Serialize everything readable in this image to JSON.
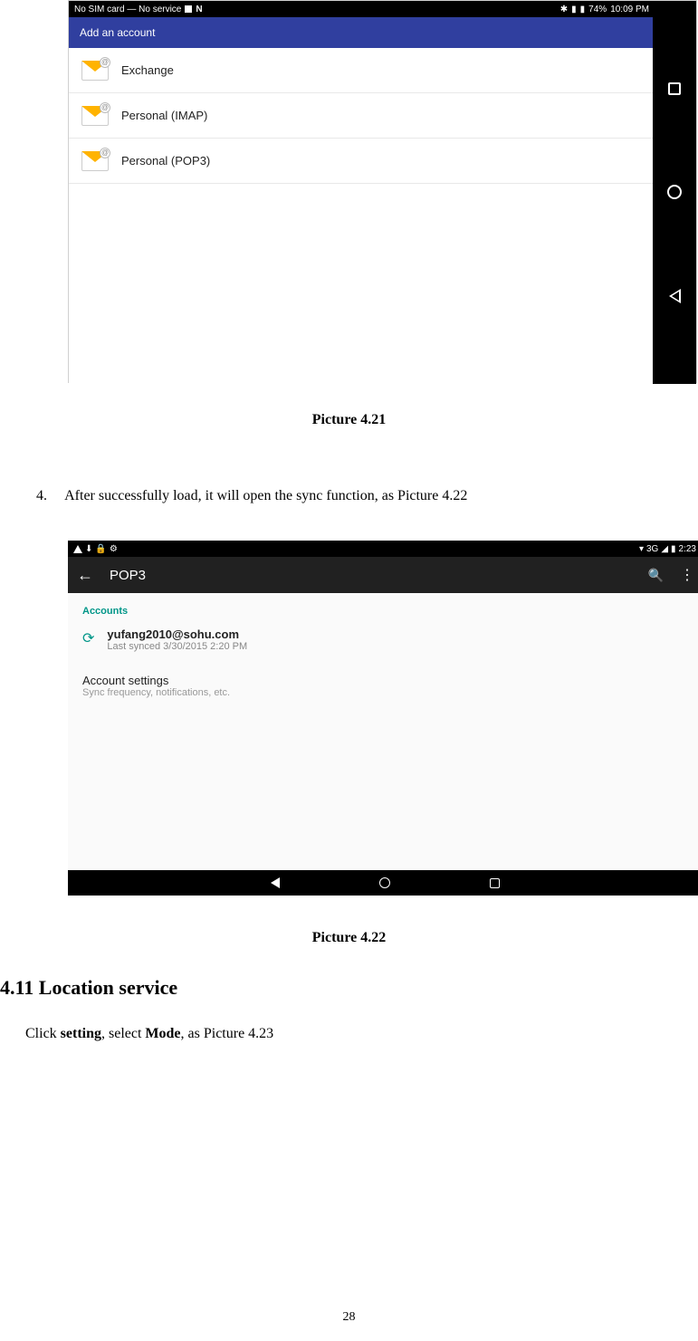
{
  "shot1": {
    "status": {
      "sim": "No SIM card — No service",
      "battery": "74%",
      "time": "10:09 PM"
    },
    "header": "Add an account",
    "rows": [
      "Exchange",
      "Personal (IMAP)",
      "Personal (POP3)"
    ]
  },
  "caption1": "Picture 4.21",
  "step4": {
    "num": "4.",
    "text": "After successfully load, it will open the sync function, as Picture 4.22"
  },
  "shot2": {
    "status": {
      "net": "3G",
      "time": "2:23"
    },
    "appbar": {
      "title": "POP3"
    },
    "section_label": "Accounts",
    "account": {
      "email": "yufang2010@sohu.com",
      "sub": "Last synced 3/30/2015 2:20 PM"
    },
    "settings": {
      "title": "Account settings",
      "sub": "Sync frequency, notifications, etc."
    }
  },
  "caption2": "Picture 4.22",
  "heading": "4.11 Location service",
  "para": {
    "t1": "Click ",
    "b1": "setting",
    "t2": ", select ",
    "b2": "Mode",
    "t3": ", as Picture 4.23"
  },
  "page_number": "28"
}
